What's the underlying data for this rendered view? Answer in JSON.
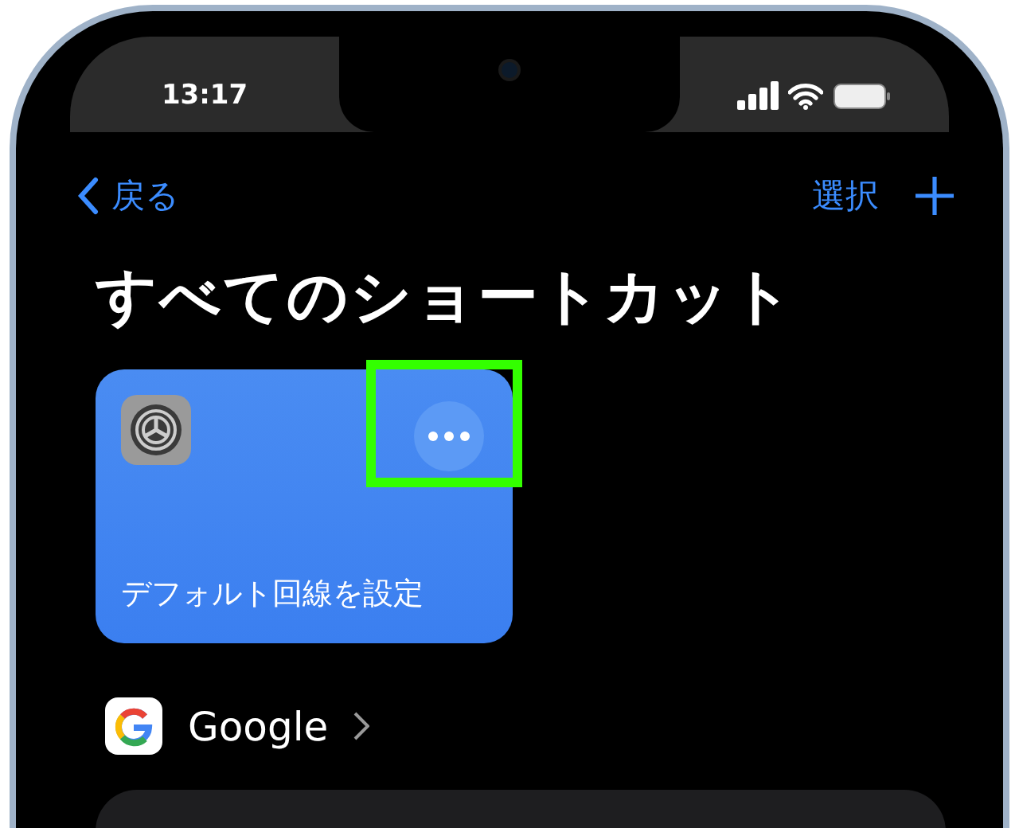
{
  "status_bar": {
    "time": "13:17"
  },
  "nav": {
    "back_label": "戻る",
    "select_label": "選択"
  },
  "title": "すべてのショートカット",
  "shortcuts": [
    {
      "title": "デフォルト回線を設定",
      "menu_highlighted": true
    }
  ],
  "folder": {
    "name": "Google"
  }
}
